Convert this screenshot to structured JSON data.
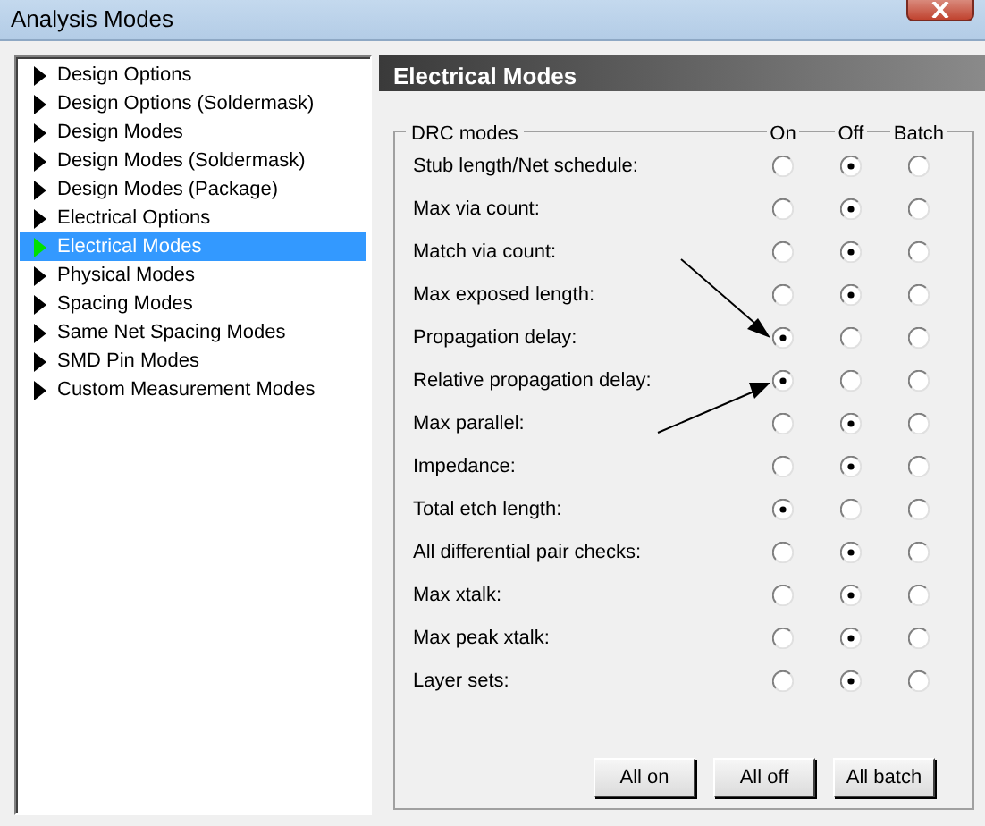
{
  "window": {
    "title": "Analysis Modes"
  },
  "sidebar": {
    "items": [
      {
        "label": "Design Options",
        "selected": false
      },
      {
        "label": "Design Options (Soldermask)",
        "selected": false
      },
      {
        "label": "Design Modes",
        "selected": false
      },
      {
        "label": "Design Modes (Soldermask)",
        "selected": false
      },
      {
        "label": "Design Modes (Package)",
        "selected": false
      },
      {
        "label": "Electrical Options",
        "selected": false
      },
      {
        "label": "Electrical Modes",
        "selected": true
      },
      {
        "label": "Physical Modes",
        "selected": false
      },
      {
        "label": "Spacing Modes",
        "selected": false
      },
      {
        "label": "Same Net Spacing Modes",
        "selected": false
      },
      {
        "label": "SMD Pin Modes",
        "selected": false
      },
      {
        "label": "Custom Measurement Modes",
        "selected": false
      }
    ]
  },
  "panel": {
    "title": "Electrical Modes",
    "group": "DRC modes",
    "columns": [
      "On",
      "Off",
      "Batch"
    ],
    "rows": [
      {
        "label": "Stub length/Net schedule:",
        "options": [
          {
            "selected": false
          },
          {
            "selected": true
          },
          {
            "selected": false
          }
        ]
      },
      {
        "label": "Max via count:",
        "options": [
          {
            "selected": false
          },
          {
            "selected": true
          },
          {
            "selected": false
          }
        ]
      },
      {
        "label": "Match via count:",
        "options": [
          {
            "selected": false
          },
          {
            "selected": true
          },
          {
            "selected": false
          }
        ]
      },
      {
        "label": "Max exposed length:",
        "options": [
          {
            "selected": false
          },
          {
            "selected": true
          },
          {
            "selected": false
          }
        ]
      },
      {
        "label": "Propagation delay:",
        "options": [
          {
            "selected": true
          },
          {
            "selected": false
          },
          {
            "selected": false
          }
        ]
      },
      {
        "label": "Relative propagation delay:",
        "options": [
          {
            "selected": true
          },
          {
            "selected": false
          },
          {
            "selected": false
          }
        ]
      },
      {
        "label": "Max parallel:",
        "options": [
          {
            "selected": false
          },
          {
            "selected": true
          },
          {
            "selected": false
          }
        ]
      },
      {
        "label": "Impedance:",
        "options": [
          {
            "selected": false
          },
          {
            "selected": true
          },
          {
            "selected": false
          }
        ]
      },
      {
        "label": "Total etch length:",
        "options": [
          {
            "selected": true
          },
          {
            "selected": false
          },
          {
            "selected": false
          }
        ]
      },
      {
        "label": "All differential pair checks:",
        "options": [
          {
            "selected": false
          },
          {
            "selected": true
          },
          {
            "selected": false
          }
        ]
      },
      {
        "label": "Max xtalk:",
        "options": [
          {
            "selected": false
          },
          {
            "selected": true
          },
          {
            "selected": false
          }
        ]
      },
      {
        "label": "Max peak xtalk:",
        "options": [
          {
            "selected": false
          },
          {
            "selected": true
          },
          {
            "selected": false
          }
        ]
      },
      {
        "label": "Layer sets:",
        "options": [
          {
            "selected": false
          },
          {
            "selected": true
          },
          {
            "selected": false
          }
        ]
      }
    ],
    "buttons": [
      "All on",
      "All off",
      "All batch"
    ]
  }
}
